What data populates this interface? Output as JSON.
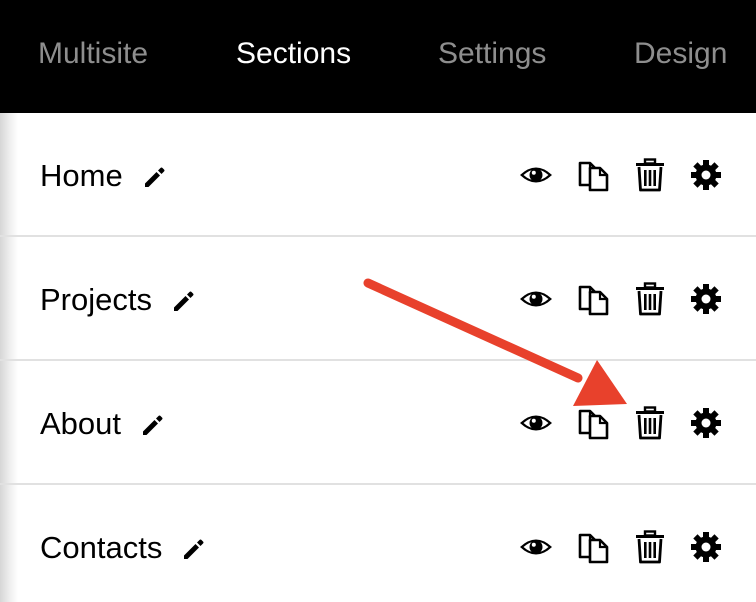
{
  "nav": {
    "tabs": [
      {
        "label": "Multisite",
        "active": false
      },
      {
        "label": "Sections",
        "active": true
      },
      {
        "label": "Settings",
        "active": false
      },
      {
        "label": "Design",
        "active": false
      }
    ]
  },
  "sections": [
    {
      "label": "Home"
    },
    {
      "label": "Projects"
    },
    {
      "label": "About"
    },
    {
      "label": "Contacts"
    }
  ],
  "icons": {
    "rename": "pencil-icon",
    "preview": "eye-icon",
    "duplicate": "copy-icon",
    "delete": "trash-icon",
    "settings": "gear-icon"
  },
  "colors": {
    "nav_background": "#000000",
    "nav_active": "#ffffff",
    "nav_inactive": "#8e8e8e",
    "annotation_arrow": "#e8412c",
    "divider": "#e1e1e1"
  }
}
